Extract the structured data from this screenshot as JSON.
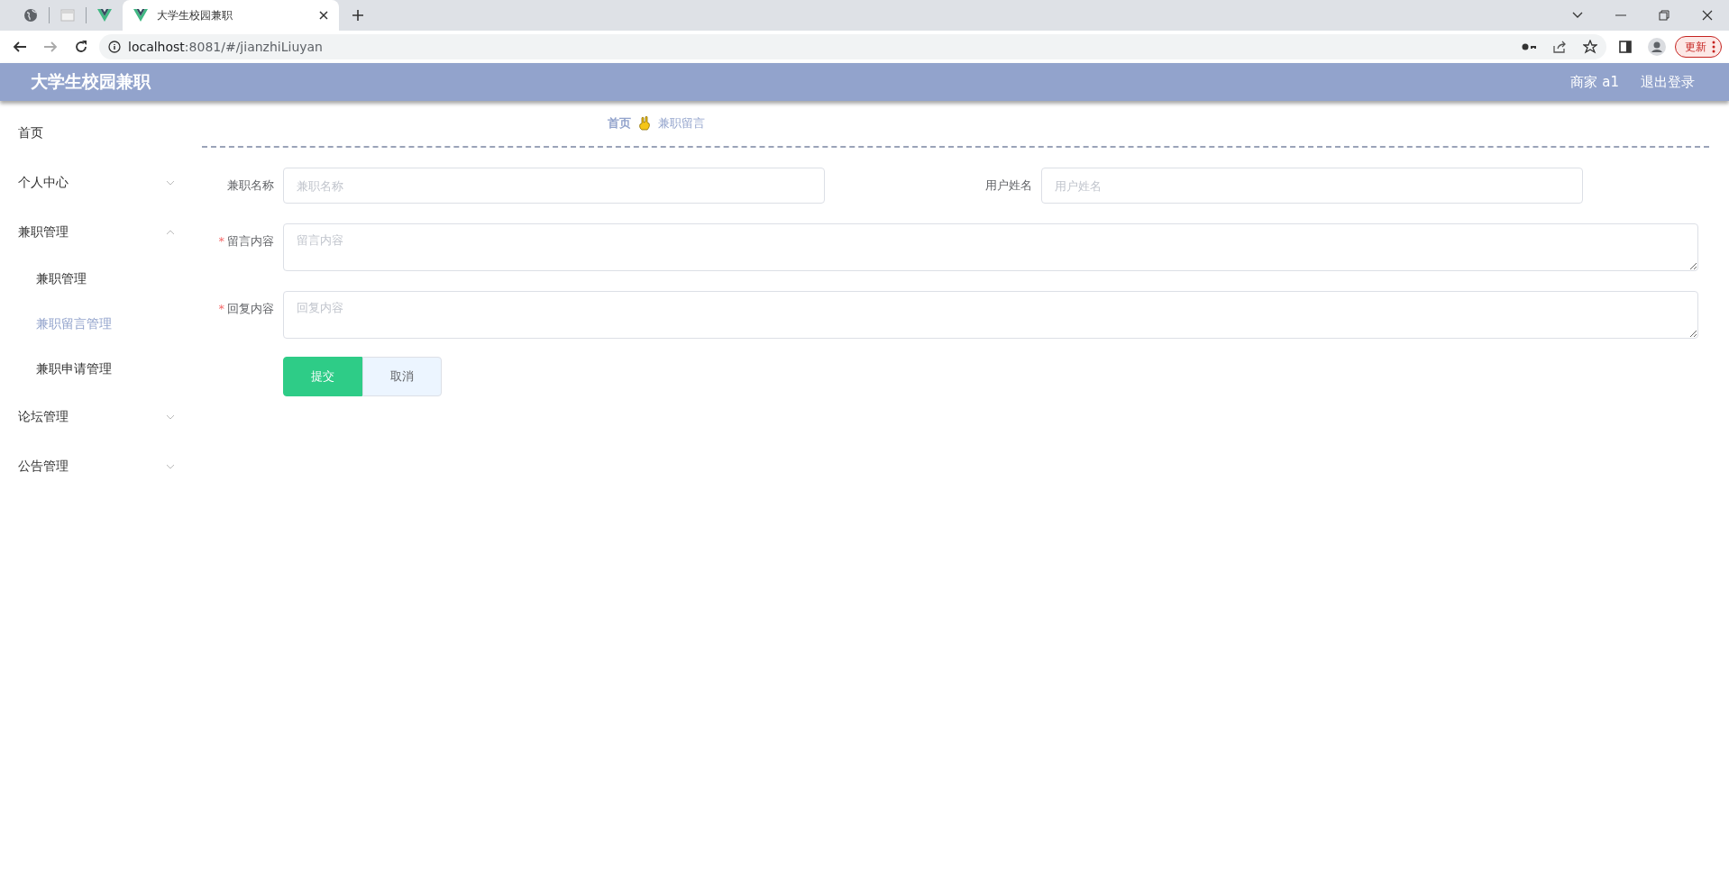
{
  "browser": {
    "tabs": [
      {
        "kind": "globe",
        "selected": false
      },
      {
        "kind": "sheet",
        "selected": false
      },
      {
        "kind": "vue",
        "selected": false
      },
      {
        "kind": "vue",
        "title": "大学生校园兼职",
        "selected": true
      }
    ],
    "url_host": "localhost",
    "url_rest": ":8081/#/jianzhiLiuyan",
    "update_label": "更新"
  },
  "header": {
    "title": "大学生校园兼职",
    "user": "商家 a1",
    "logout": "退出登录"
  },
  "sidebar": {
    "items": [
      {
        "label": "首页"
      },
      {
        "label": "个人中心",
        "expanded": false
      },
      {
        "label": "兼职管理",
        "expanded": true,
        "children": [
          {
            "label": "兼职管理",
            "selected": false
          },
          {
            "label": "兼职留言管理",
            "selected": true
          },
          {
            "label": "兼职申请管理",
            "selected": false
          }
        ]
      },
      {
        "label": "论坛管理",
        "expanded": false
      },
      {
        "label": "公告管理",
        "expanded": false
      }
    ]
  },
  "breadcrumb": [
    "首页",
    "兼职留言"
  ],
  "form": {
    "rows": [
      {
        "fields": [
          {
            "kind": "input",
            "label": "兼职名称",
            "placeholder": "兼职名称"
          },
          {
            "kind": "input",
            "label": "用户姓名",
            "placeholder": "用户姓名"
          }
        ]
      },
      {
        "fields": [
          {
            "kind": "textarea",
            "required_mark": "*",
            "label": "留言内容",
            "placeholder": "留言内容"
          }
        ]
      },
      {
        "fields": [
          {
            "kind": "textarea",
            "required_mark": "*",
            "label": "回复内容",
            "placeholder": "回复内容"
          }
        ]
      }
    ],
    "buttons": [
      {
        "kind": "primary",
        "label": "提交"
      },
      {
        "kind": "plain",
        "label": "取消"
      }
    ]
  }
}
